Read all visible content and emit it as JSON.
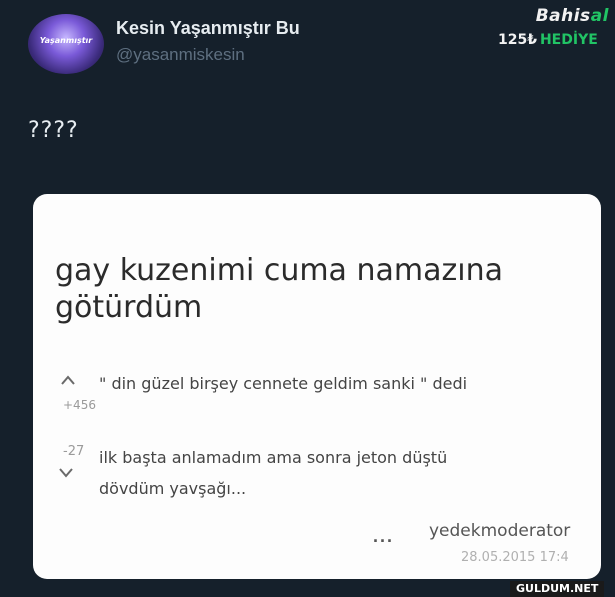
{
  "tweet": {
    "author_name": "Kesin Yaşanmıştır Bu",
    "handle": "@yasanmiskesin",
    "avatar_text": "Yaşanmıştır",
    "text": "????"
  },
  "ad": {
    "brand_main": "Bahis",
    "brand_accent": "al",
    "bonus_amount": "125₺",
    "bonus_label": "HEDİYE"
  },
  "post": {
    "title": "gay kuzenimi cuma namazına götürdüm",
    "upvote_score": "+456",
    "downvote_score": "-27",
    "comment_line1": "\" din güzel birşey cennete geldim sanki \" dedi",
    "comment_line2": "ilk başta anlamadım ama sonra jeton düştü",
    "comment_line3": "dövdüm yavşağı...",
    "more": "...",
    "author": "yedekmoderator",
    "date": "28.05.2015 17:4"
  },
  "watermark": "GULDUM.NET",
  "icons": {
    "upvote": "chevron-up-icon",
    "downvote": "chevron-down-icon"
  },
  "colors": {
    "background": "#15202b",
    "card": "#fdfdfd",
    "ad_accent": "#21c465"
  }
}
